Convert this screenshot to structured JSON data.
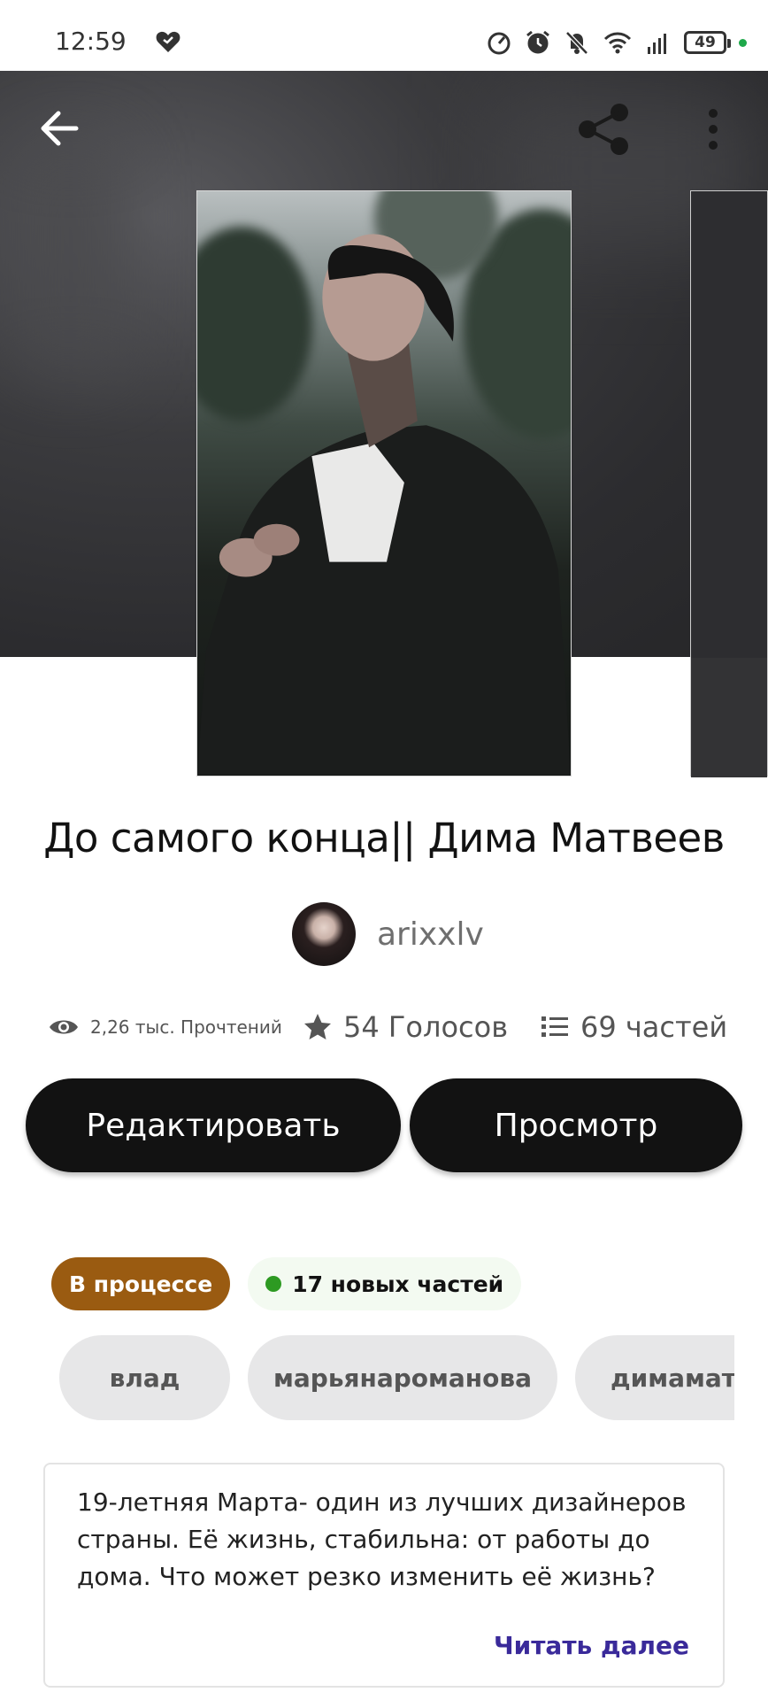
{
  "status_bar": {
    "time": "12:59",
    "battery": "49",
    "icons": [
      "heart-icon",
      "speed-icon",
      "alarm-icon",
      "mute-icon",
      "wifi-icon",
      "signal-icon",
      "battery-icon"
    ]
  },
  "header": {
    "back_icon": "arrow-left-icon",
    "share_icon": "share-icon",
    "more_icon": "more-vertical-icon"
  },
  "story": {
    "title": "До самого конца|| Дима Матвеев",
    "author": "arixxlv",
    "stats": {
      "reads": "2,26 тыс. Прочтений",
      "votes": "54 Голосов",
      "parts": "69 частей"
    },
    "buttons": {
      "edit": "Редактировать",
      "preview": "Просмотр"
    },
    "status_badge": "В процессе",
    "new_parts_badge": "17 новых частей",
    "tags": [
      "влад",
      "марьянароманова",
      "димаматвеев"
    ],
    "description": "19-летняя Марта- один из лучших дизайнеров страны. Её жизнь, стабильна: от работы до дома. Что может резко изменить её жизнь?",
    "read_more": "Читать далее"
  },
  "colors": {
    "status_badge_bg": "#9a5b11",
    "new_dot": "#2d9a22",
    "read_more": "#3a2a9a",
    "button_bg": "#121212"
  }
}
